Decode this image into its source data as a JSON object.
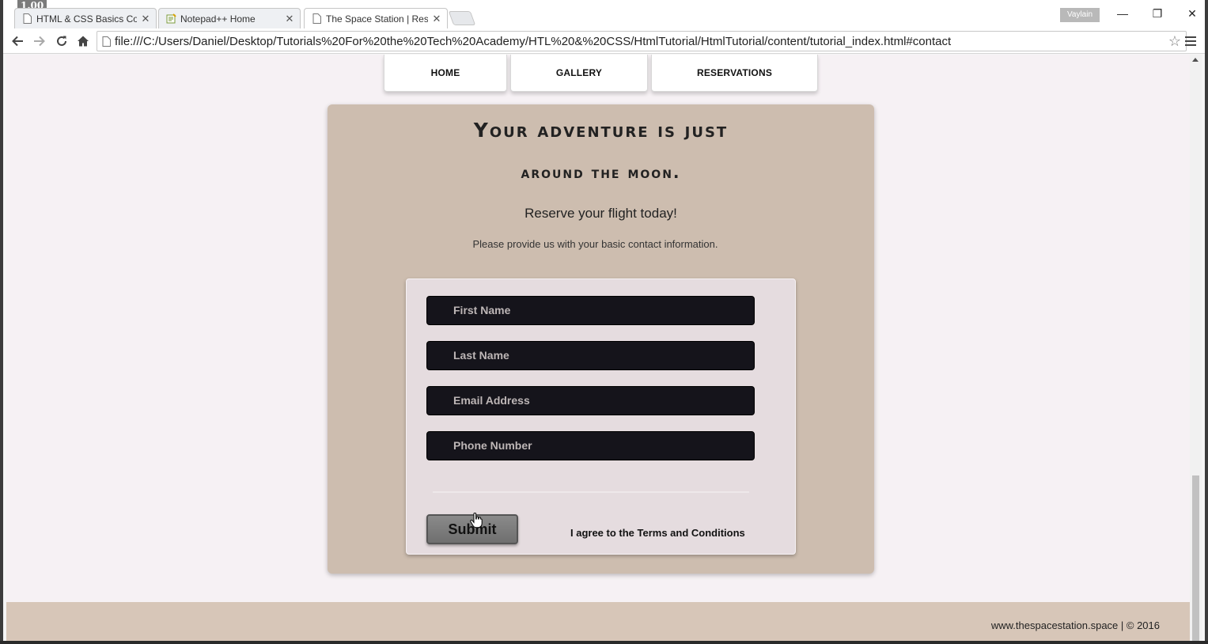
{
  "browser": {
    "overlay_counter": "1.00",
    "tabs": [
      {
        "title": "HTML & CSS Basics Cours",
        "active": false
      },
      {
        "title": "Notepad++ Home",
        "active": false
      },
      {
        "title": "The Space Station | Resort",
        "active": true
      }
    ],
    "user_label": "Vaylain",
    "url": "file:///C:/Users/Daniel/Desktop/Tutorials%20For%20the%20Tech%20Academy/HTL%20&%20CSS/HtmlTutorial/HtmlTutorial/content/tutorial_index.html#contact"
  },
  "nav": {
    "items": [
      {
        "label": "HOME"
      },
      {
        "label": "GALLERY"
      },
      {
        "label": "RESERVATIONS"
      }
    ]
  },
  "contact": {
    "heading_line1": "Your adventure is just",
    "heading_line2": "around the moon.",
    "subtitle": "Reserve your flight today!",
    "info": "Please provide us with your basic contact information.",
    "fields": [
      {
        "placeholder": "First Name"
      },
      {
        "placeholder": "Last Name"
      },
      {
        "placeholder": "Email Address"
      },
      {
        "placeholder": "Phone Number"
      }
    ],
    "submit_label": "Submit",
    "terms_label": "I agree to the Terms and Conditions"
  },
  "footer": {
    "text": "www.thespacestation.space  |  © 2016"
  },
  "colors": {
    "page_bg": "#f6f1f4",
    "panel_bg": "#cdbdaf",
    "form_bg": "#e5dcdf",
    "field_bg": "#15141b",
    "footer_bg": "#d7c6b8"
  }
}
